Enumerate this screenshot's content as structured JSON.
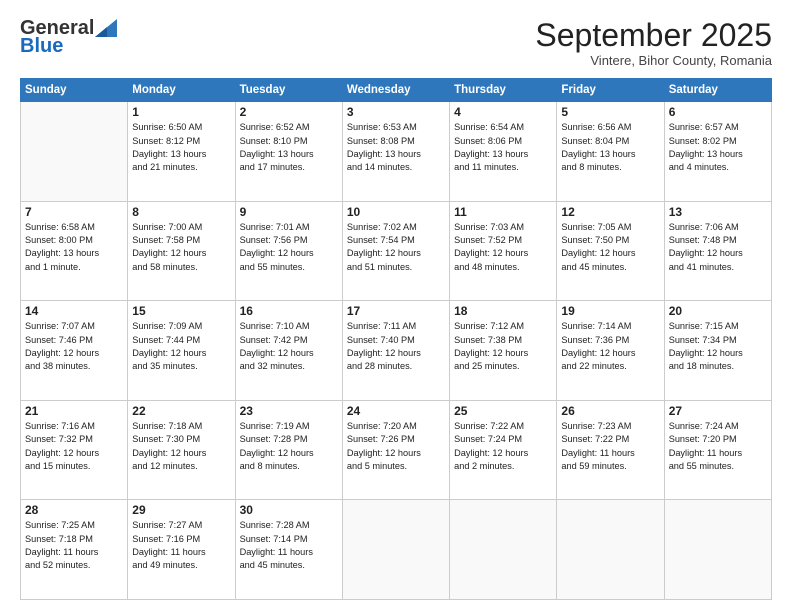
{
  "logo": {
    "general": "General",
    "blue": "Blue"
  },
  "header": {
    "month": "September 2025",
    "location": "Vintere, Bihor County, Romania"
  },
  "days_of_week": [
    "Sunday",
    "Monday",
    "Tuesday",
    "Wednesday",
    "Thursday",
    "Friday",
    "Saturday"
  ],
  "weeks": [
    [
      {
        "day": "",
        "info": ""
      },
      {
        "day": "1",
        "info": "Sunrise: 6:50 AM\nSunset: 8:12 PM\nDaylight: 13 hours\nand 21 minutes."
      },
      {
        "day": "2",
        "info": "Sunrise: 6:52 AM\nSunset: 8:10 PM\nDaylight: 13 hours\nand 17 minutes."
      },
      {
        "day": "3",
        "info": "Sunrise: 6:53 AM\nSunset: 8:08 PM\nDaylight: 13 hours\nand 14 minutes."
      },
      {
        "day": "4",
        "info": "Sunrise: 6:54 AM\nSunset: 8:06 PM\nDaylight: 13 hours\nand 11 minutes."
      },
      {
        "day": "5",
        "info": "Sunrise: 6:56 AM\nSunset: 8:04 PM\nDaylight: 13 hours\nand 8 minutes."
      },
      {
        "day": "6",
        "info": "Sunrise: 6:57 AM\nSunset: 8:02 PM\nDaylight: 13 hours\nand 4 minutes."
      }
    ],
    [
      {
        "day": "7",
        "info": "Sunrise: 6:58 AM\nSunset: 8:00 PM\nDaylight: 13 hours\nand 1 minute."
      },
      {
        "day": "8",
        "info": "Sunrise: 7:00 AM\nSunset: 7:58 PM\nDaylight: 12 hours\nand 58 minutes."
      },
      {
        "day": "9",
        "info": "Sunrise: 7:01 AM\nSunset: 7:56 PM\nDaylight: 12 hours\nand 55 minutes."
      },
      {
        "day": "10",
        "info": "Sunrise: 7:02 AM\nSunset: 7:54 PM\nDaylight: 12 hours\nand 51 minutes."
      },
      {
        "day": "11",
        "info": "Sunrise: 7:03 AM\nSunset: 7:52 PM\nDaylight: 12 hours\nand 48 minutes."
      },
      {
        "day": "12",
        "info": "Sunrise: 7:05 AM\nSunset: 7:50 PM\nDaylight: 12 hours\nand 45 minutes."
      },
      {
        "day": "13",
        "info": "Sunrise: 7:06 AM\nSunset: 7:48 PM\nDaylight: 12 hours\nand 41 minutes."
      }
    ],
    [
      {
        "day": "14",
        "info": "Sunrise: 7:07 AM\nSunset: 7:46 PM\nDaylight: 12 hours\nand 38 minutes."
      },
      {
        "day": "15",
        "info": "Sunrise: 7:09 AM\nSunset: 7:44 PM\nDaylight: 12 hours\nand 35 minutes."
      },
      {
        "day": "16",
        "info": "Sunrise: 7:10 AM\nSunset: 7:42 PM\nDaylight: 12 hours\nand 32 minutes."
      },
      {
        "day": "17",
        "info": "Sunrise: 7:11 AM\nSunset: 7:40 PM\nDaylight: 12 hours\nand 28 minutes."
      },
      {
        "day": "18",
        "info": "Sunrise: 7:12 AM\nSunset: 7:38 PM\nDaylight: 12 hours\nand 25 minutes."
      },
      {
        "day": "19",
        "info": "Sunrise: 7:14 AM\nSunset: 7:36 PM\nDaylight: 12 hours\nand 22 minutes."
      },
      {
        "day": "20",
        "info": "Sunrise: 7:15 AM\nSunset: 7:34 PM\nDaylight: 12 hours\nand 18 minutes."
      }
    ],
    [
      {
        "day": "21",
        "info": "Sunrise: 7:16 AM\nSunset: 7:32 PM\nDaylight: 12 hours\nand 15 minutes."
      },
      {
        "day": "22",
        "info": "Sunrise: 7:18 AM\nSunset: 7:30 PM\nDaylight: 12 hours\nand 12 minutes."
      },
      {
        "day": "23",
        "info": "Sunrise: 7:19 AM\nSunset: 7:28 PM\nDaylight: 12 hours\nand 8 minutes."
      },
      {
        "day": "24",
        "info": "Sunrise: 7:20 AM\nSunset: 7:26 PM\nDaylight: 12 hours\nand 5 minutes."
      },
      {
        "day": "25",
        "info": "Sunrise: 7:22 AM\nSunset: 7:24 PM\nDaylight: 12 hours\nand 2 minutes."
      },
      {
        "day": "26",
        "info": "Sunrise: 7:23 AM\nSunset: 7:22 PM\nDaylight: 11 hours\nand 59 minutes."
      },
      {
        "day": "27",
        "info": "Sunrise: 7:24 AM\nSunset: 7:20 PM\nDaylight: 11 hours\nand 55 minutes."
      }
    ],
    [
      {
        "day": "28",
        "info": "Sunrise: 7:25 AM\nSunset: 7:18 PM\nDaylight: 11 hours\nand 52 minutes."
      },
      {
        "day": "29",
        "info": "Sunrise: 7:27 AM\nSunset: 7:16 PM\nDaylight: 11 hours\nand 49 minutes."
      },
      {
        "day": "30",
        "info": "Sunrise: 7:28 AM\nSunset: 7:14 PM\nDaylight: 11 hours\nand 45 minutes."
      },
      {
        "day": "",
        "info": ""
      },
      {
        "day": "",
        "info": ""
      },
      {
        "day": "",
        "info": ""
      },
      {
        "day": "",
        "info": ""
      }
    ]
  ]
}
